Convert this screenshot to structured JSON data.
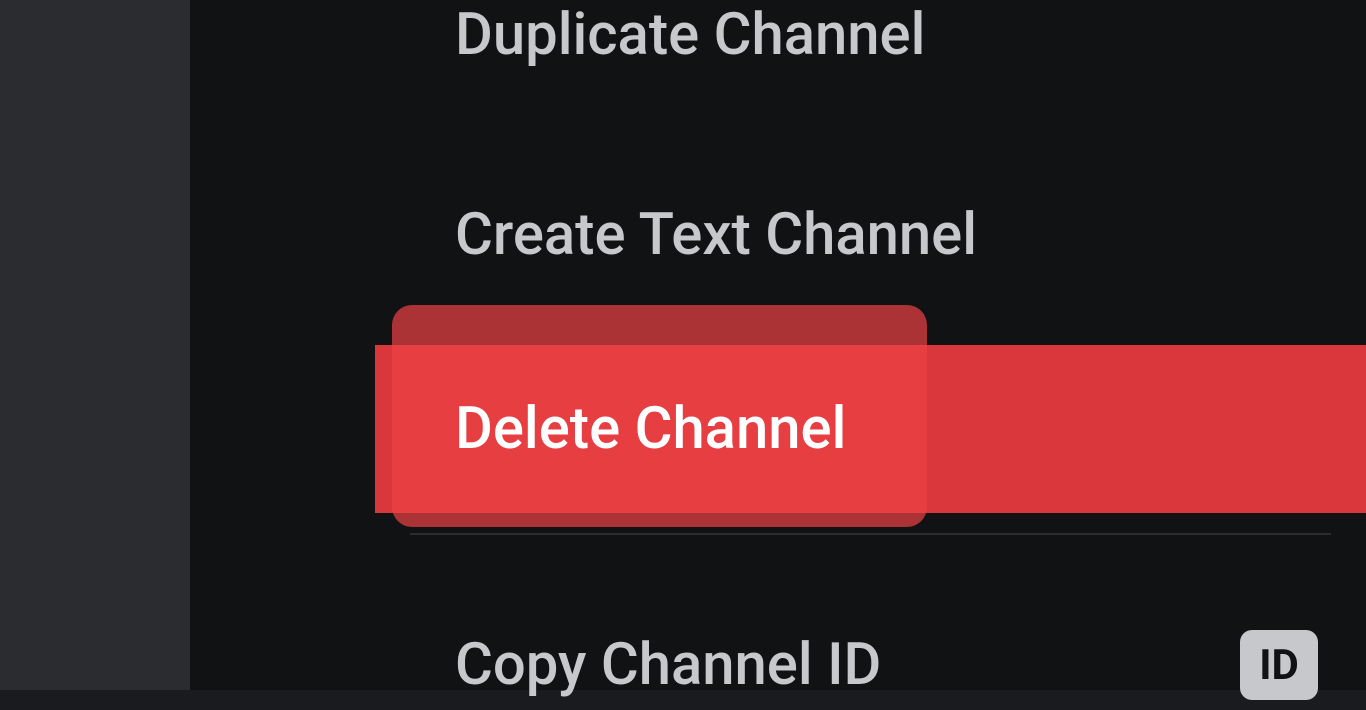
{
  "menu": {
    "duplicate_label": "Duplicate Channel",
    "create_label": "Create Text Channel",
    "delete_label": "Delete Channel",
    "copy_id_label": "Copy Channel ID",
    "id_badge": "ID"
  }
}
